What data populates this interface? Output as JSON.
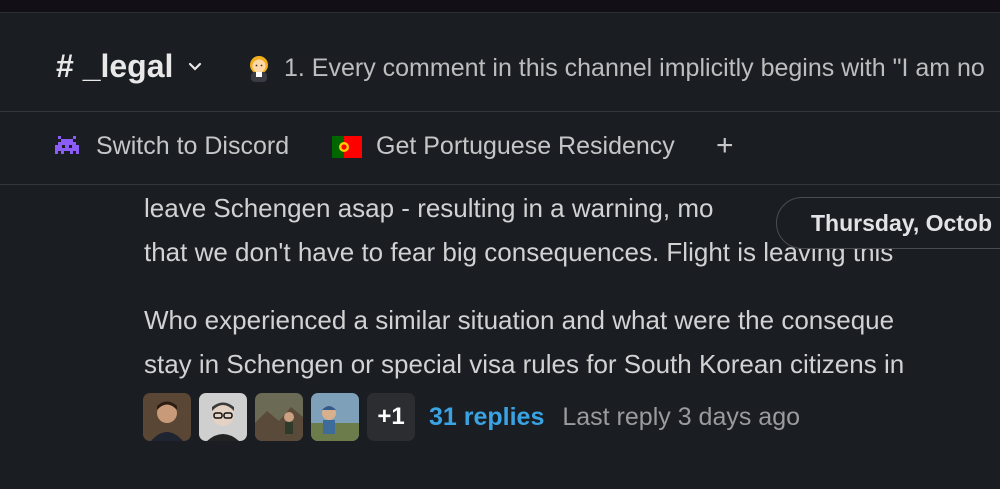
{
  "header": {
    "channel_name": "# _legal",
    "topic_emoji": "woman-judge-emoji",
    "topic_text": "1. Every comment in this channel implicitly begins with \"I am no"
  },
  "bookmarks": [
    {
      "icon": "alien-monster-icon",
      "label": "Switch to Discord"
    },
    {
      "icon": "portugal-flag-icon",
      "label": "Get Portuguese Residency"
    }
  ],
  "add_bookmark_label": "+",
  "message": {
    "line1": "leave Schengen asap - resulting in a warning, mo",
    "line2": "that we don't have to fear big consequences. Flight is leaving this",
    "para2_line1": "Who experienced a similar situation and what were the conseque",
    "para2_line2": "stay in Schengen or special visa rules for South Korean citizens in"
  },
  "date_divider": "Thursday, Octob",
  "thread": {
    "more_count": "+1",
    "replies": "31 replies",
    "last_reply": "Last reply 3 days ago"
  },
  "colors": {
    "background": "#1a1d21",
    "link": "#3aa3e3",
    "text": "#d1d2d3"
  }
}
